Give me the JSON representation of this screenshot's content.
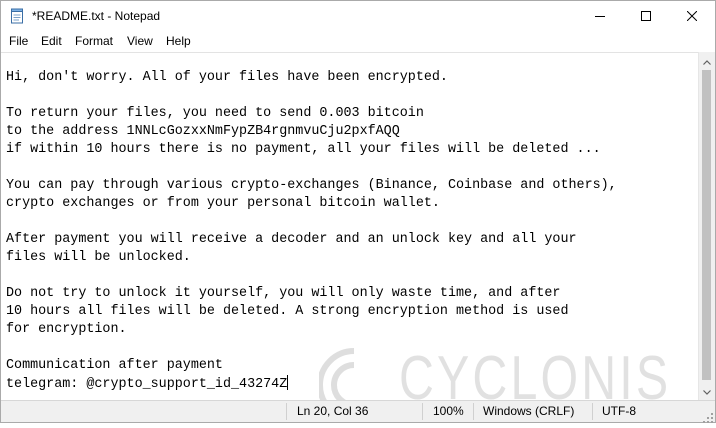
{
  "window": {
    "title": "*README.txt - Notepad"
  },
  "titlebar": {
    "icons": {
      "app": "notepad-icon",
      "minimize": "minimize-icon",
      "maximize": "maximize-icon",
      "close": "close-icon"
    }
  },
  "menu": [
    "File",
    "Edit",
    "Format",
    "View",
    "Help"
  ],
  "editor": {
    "lines": [
      "Hi, don't worry. All of your files have been encrypted.",
      "",
      "To return your files, you need to send 0.003 bitcoin",
      "to the address 1NNLcGozxxNmFypZB4rgnmvuCju2pxfAQQ",
      "if within 10 hours there is no payment, all your files will be deleted ...",
      "",
      "You can pay through various crypto-exchanges (Binance, Coinbase and others),",
      "crypto exchanges or from your personal bitcoin wallet.",
      "",
      "After payment you will receive a decoder and an unlock key and all your",
      "files will be unlocked.",
      "",
      "Do not try to unlock it yourself, you will only waste time, and after",
      "10 hours all files will be deleted. A strong encryption method is used",
      "for encryption.",
      "",
      "Communication after payment",
      "telegram: @crypto_support_id_43274Z"
    ]
  },
  "watermark": {
    "text": "CYCLONIS"
  },
  "statusbar": {
    "position": "Ln 20, Col 36",
    "zoom": "100%",
    "line_ending": "Windows (CRLF)",
    "encoding": "UTF-8"
  }
}
